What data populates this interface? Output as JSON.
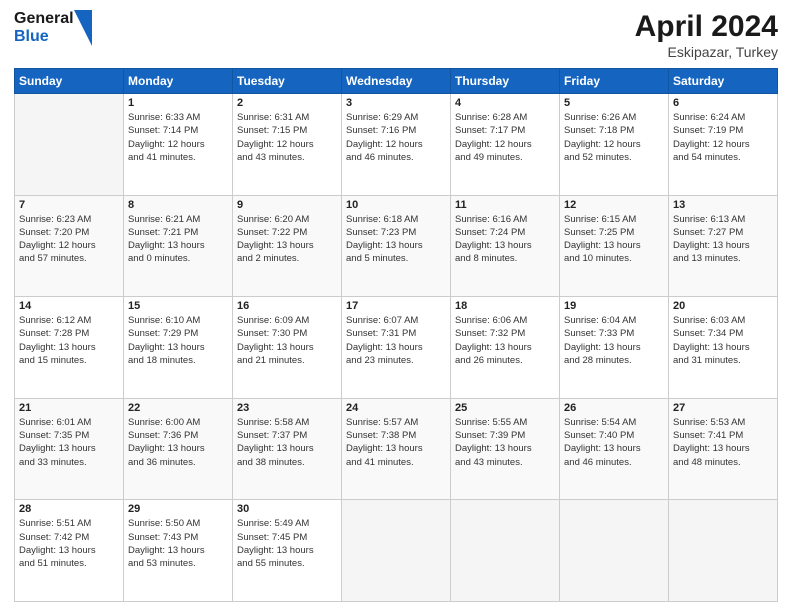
{
  "header": {
    "logo_line1": "General",
    "logo_line2": "Blue",
    "month_title": "April 2024",
    "location": "Eskipazar, Turkey"
  },
  "days_of_week": [
    "Sunday",
    "Monday",
    "Tuesday",
    "Wednesday",
    "Thursday",
    "Friday",
    "Saturday"
  ],
  "weeks": [
    [
      {
        "day": "",
        "info": ""
      },
      {
        "day": "1",
        "info": "Sunrise: 6:33 AM\nSunset: 7:14 PM\nDaylight: 12 hours\nand 41 minutes."
      },
      {
        "day": "2",
        "info": "Sunrise: 6:31 AM\nSunset: 7:15 PM\nDaylight: 12 hours\nand 43 minutes."
      },
      {
        "day": "3",
        "info": "Sunrise: 6:29 AM\nSunset: 7:16 PM\nDaylight: 12 hours\nand 46 minutes."
      },
      {
        "day": "4",
        "info": "Sunrise: 6:28 AM\nSunset: 7:17 PM\nDaylight: 12 hours\nand 49 minutes."
      },
      {
        "day": "5",
        "info": "Sunrise: 6:26 AM\nSunset: 7:18 PM\nDaylight: 12 hours\nand 52 minutes."
      },
      {
        "day": "6",
        "info": "Sunrise: 6:24 AM\nSunset: 7:19 PM\nDaylight: 12 hours\nand 54 minutes."
      }
    ],
    [
      {
        "day": "7",
        "info": "Sunrise: 6:23 AM\nSunset: 7:20 PM\nDaylight: 12 hours\nand 57 minutes."
      },
      {
        "day": "8",
        "info": "Sunrise: 6:21 AM\nSunset: 7:21 PM\nDaylight: 13 hours\nand 0 minutes."
      },
      {
        "day": "9",
        "info": "Sunrise: 6:20 AM\nSunset: 7:22 PM\nDaylight: 13 hours\nand 2 minutes."
      },
      {
        "day": "10",
        "info": "Sunrise: 6:18 AM\nSunset: 7:23 PM\nDaylight: 13 hours\nand 5 minutes."
      },
      {
        "day": "11",
        "info": "Sunrise: 6:16 AM\nSunset: 7:24 PM\nDaylight: 13 hours\nand 8 minutes."
      },
      {
        "day": "12",
        "info": "Sunrise: 6:15 AM\nSunset: 7:25 PM\nDaylight: 13 hours\nand 10 minutes."
      },
      {
        "day": "13",
        "info": "Sunrise: 6:13 AM\nSunset: 7:27 PM\nDaylight: 13 hours\nand 13 minutes."
      }
    ],
    [
      {
        "day": "14",
        "info": "Sunrise: 6:12 AM\nSunset: 7:28 PM\nDaylight: 13 hours\nand 15 minutes."
      },
      {
        "day": "15",
        "info": "Sunrise: 6:10 AM\nSunset: 7:29 PM\nDaylight: 13 hours\nand 18 minutes."
      },
      {
        "day": "16",
        "info": "Sunrise: 6:09 AM\nSunset: 7:30 PM\nDaylight: 13 hours\nand 21 minutes."
      },
      {
        "day": "17",
        "info": "Sunrise: 6:07 AM\nSunset: 7:31 PM\nDaylight: 13 hours\nand 23 minutes."
      },
      {
        "day": "18",
        "info": "Sunrise: 6:06 AM\nSunset: 7:32 PM\nDaylight: 13 hours\nand 26 minutes."
      },
      {
        "day": "19",
        "info": "Sunrise: 6:04 AM\nSunset: 7:33 PM\nDaylight: 13 hours\nand 28 minutes."
      },
      {
        "day": "20",
        "info": "Sunrise: 6:03 AM\nSunset: 7:34 PM\nDaylight: 13 hours\nand 31 minutes."
      }
    ],
    [
      {
        "day": "21",
        "info": "Sunrise: 6:01 AM\nSunset: 7:35 PM\nDaylight: 13 hours\nand 33 minutes."
      },
      {
        "day": "22",
        "info": "Sunrise: 6:00 AM\nSunset: 7:36 PM\nDaylight: 13 hours\nand 36 minutes."
      },
      {
        "day": "23",
        "info": "Sunrise: 5:58 AM\nSunset: 7:37 PM\nDaylight: 13 hours\nand 38 minutes."
      },
      {
        "day": "24",
        "info": "Sunrise: 5:57 AM\nSunset: 7:38 PM\nDaylight: 13 hours\nand 41 minutes."
      },
      {
        "day": "25",
        "info": "Sunrise: 5:55 AM\nSunset: 7:39 PM\nDaylight: 13 hours\nand 43 minutes."
      },
      {
        "day": "26",
        "info": "Sunrise: 5:54 AM\nSunset: 7:40 PM\nDaylight: 13 hours\nand 46 minutes."
      },
      {
        "day": "27",
        "info": "Sunrise: 5:53 AM\nSunset: 7:41 PM\nDaylight: 13 hours\nand 48 minutes."
      }
    ],
    [
      {
        "day": "28",
        "info": "Sunrise: 5:51 AM\nSunset: 7:42 PM\nDaylight: 13 hours\nand 51 minutes."
      },
      {
        "day": "29",
        "info": "Sunrise: 5:50 AM\nSunset: 7:43 PM\nDaylight: 13 hours\nand 53 minutes."
      },
      {
        "day": "30",
        "info": "Sunrise: 5:49 AM\nSunset: 7:45 PM\nDaylight: 13 hours\nand 55 minutes."
      },
      {
        "day": "",
        "info": ""
      },
      {
        "day": "",
        "info": ""
      },
      {
        "day": "",
        "info": ""
      },
      {
        "day": "",
        "info": ""
      }
    ]
  ]
}
